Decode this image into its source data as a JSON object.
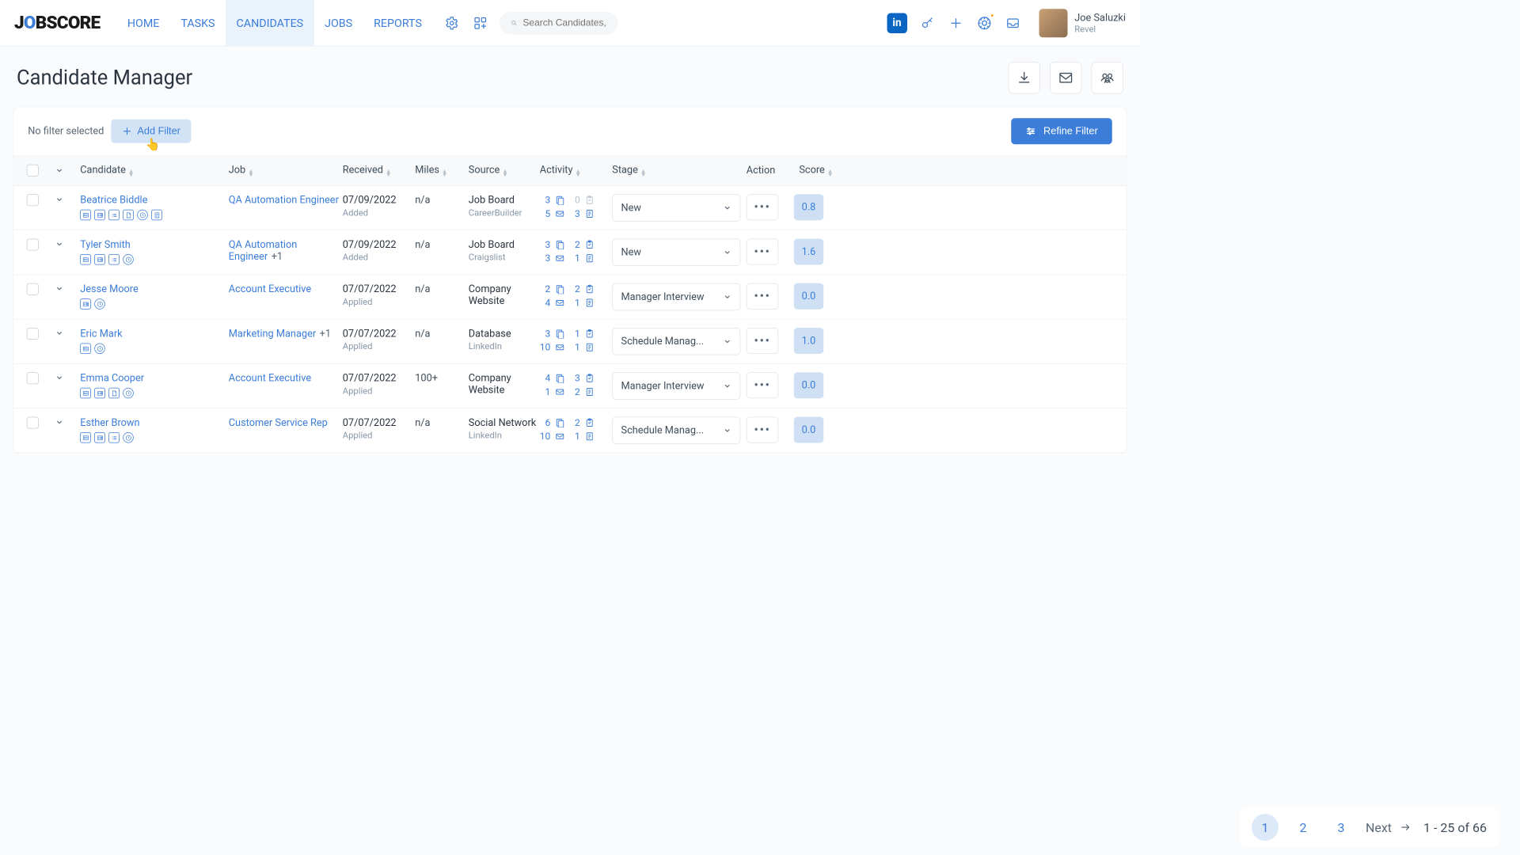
{
  "nav": {
    "home": "HOME",
    "tasks": "TASKS",
    "candidates": "CANDIDATES",
    "jobs": "JOBS",
    "reports": "REPORTS"
  },
  "search": {
    "placeholder": "Search Candidates, ..."
  },
  "user": {
    "name": "Joe Saluzki",
    "org": "Revel"
  },
  "page": {
    "title": "Candidate Manager"
  },
  "filter": {
    "none": "No filter selected",
    "add": "Add Filter",
    "refine": "Refine Filter"
  },
  "columns": {
    "candidate": "Candidate",
    "job": "Job",
    "received": "Received",
    "miles": "Miles",
    "source": "Source",
    "activity": "Activity",
    "stage": "Stage",
    "action": "Action",
    "score": "Score"
  },
  "rows": [
    {
      "name": "Beatrice Biddle",
      "icons": [
        "card",
        "id",
        "list",
        "file",
        "clock",
        "doc"
      ],
      "job": "QA Automation Engineer",
      "job_extra": "",
      "date": "07/09/2022",
      "status": "Added",
      "miles": "n/a",
      "source": "Job Board",
      "source_sub": "CareerBuilder",
      "activity": [
        {
          "n": "3",
          "z": false
        },
        {
          "n": "0",
          "z": true
        },
        {
          "n": "5",
          "z": false
        },
        {
          "n": "3",
          "z": false
        }
      ],
      "stage": "New",
      "score": "0.8"
    },
    {
      "name": "Tyler Smith",
      "icons": [
        "card",
        "id",
        "list",
        "clock"
      ],
      "job": "QA Automation Engineer",
      "job_extra": "+1",
      "date": "07/09/2022",
      "status": "Added",
      "miles": "n/a",
      "source": "Job Board",
      "source_sub": "Craigslist",
      "activity": [
        {
          "n": "3",
          "z": false
        },
        {
          "n": "2",
          "z": false
        },
        {
          "n": "3",
          "z": false
        },
        {
          "n": "1",
          "z": false
        }
      ],
      "stage": "New",
      "score": "1.6"
    },
    {
      "name": "Jesse Moore",
      "icons": [
        "id",
        "clock"
      ],
      "job": "Account Executive",
      "job_extra": "",
      "date": "07/07/2022",
      "status": "Applied",
      "miles": "n/a",
      "source": "Company Website",
      "source_sub": "",
      "activity": [
        {
          "n": "2",
          "z": false
        },
        {
          "n": "2",
          "z": false
        },
        {
          "n": "4",
          "z": false
        },
        {
          "n": "1",
          "z": false
        }
      ],
      "stage": "Manager Interview",
      "score": "0.0"
    },
    {
      "name": "Eric Mark",
      "icons": [
        "card",
        "clock"
      ],
      "job": "Marketing Manager",
      "job_extra": "+1",
      "date": "07/07/2022",
      "status": "Applied",
      "miles": "n/a",
      "source": "Database",
      "source_sub": "LinkedIn",
      "activity": [
        {
          "n": "3",
          "z": false
        },
        {
          "n": "1",
          "z": false
        },
        {
          "n": "10",
          "z": false
        },
        {
          "n": "1",
          "z": false
        }
      ],
      "stage": "Schedule Manag...",
      "score": "1.0"
    },
    {
      "name": "Emma Cooper",
      "icons": [
        "card",
        "id",
        "file",
        "clock"
      ],
      "job": "Account Executive",
      "job_extra": "",
      "date": "07/07/2022",
      "status": "Applied",
      "miles": "100+",
      "source": "Company Website",
      "source_sub": "",
      "activity": [
        {
          "n": "4",
          "z": false
        },
        {
          "n": "3",
          "z": false
        },
        {
          "n": "1",
          "z": false
        },
        {
          "n": "2",
          "z": false
        }
      ],
      "stage": "Manager Interview",
      "score": "0.0"
    },
    {
      "name": "Esther Brown",
      "icons": [
        "card",
        "id",
        "list",
        "clock"
      ],
      "job": "Customer Service Rep",
      "job_extra": "",
      "date": "07/07/2022",
      "status": "Applied",
      "miles": "n/a",
      "source": "Social Network",
      "source_sub": "LinkedIn",
      "activity": [
        {
          "n": "6",
          "z": false
        },
        {
          "n": "2",
          "z": false
        },
        {
          "n": "10",
          "z": false
        },
        {
          "n": "1",
          "z": false
        }
      ],
      "stage": "Schedule Manag...",
      "score": "0.0"
    }
  ],
  "pagination": {
    "pages": [
      "1",
      "2",
      "3"
    ],
    "next": "Next",
    "range": "1 - 25 of 66"
  }
}
